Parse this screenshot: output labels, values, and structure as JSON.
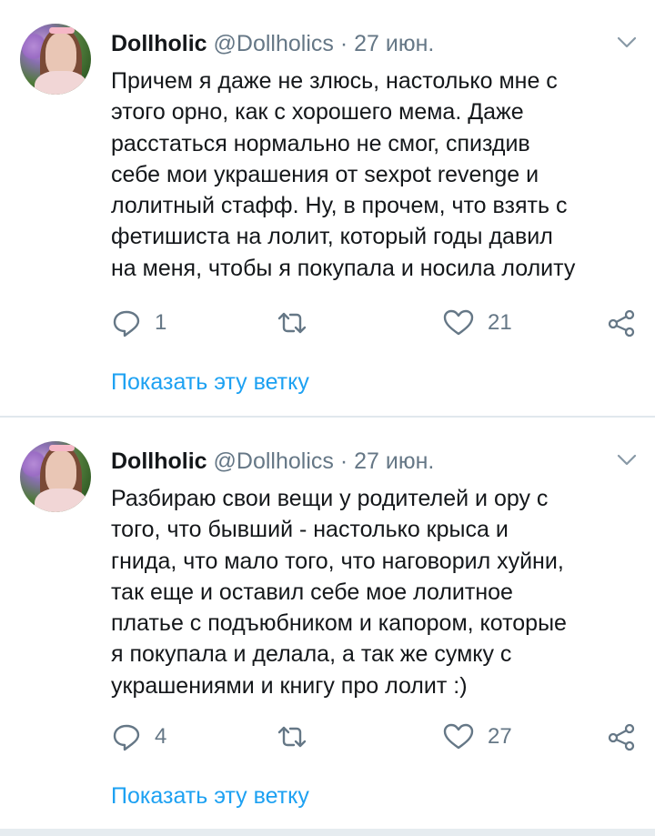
{
  "tweets": [
    {
      "author": {
        "name": "Dollholic",
        "handle": "@Dollholics",
        "separator": "·",
        "date": "27 июн."
      },
      "text_lines": [
        "Причем я даже не злюсь,  настолько мне с",
        "этого орно, как с хорошего мема. Даже",
        "расстаться нормально не смог, спиздив",
        "себе мои украшения от sexpot revenge и",
        "лолитный стафф. Ну,  в прочем,  что взять с",
        "фетишиста на лолит, который годы давил",
        "на меня, чтобы я покупала и носила лолиту"
      ],
      "actions": {
        "reply_count": "1",
        "retweet_count": "",
        "like_count": "21"
      },
      "thread_link": "Показать эту ветку"
    },
    {
      "author": {
        "name": "Dollholic",
        "handle": "@Dollholics",
        "separator": "·",
        "date": "27 июн."
      },
      "text_lines": [
        "Разбираю свои вещи у родителей и ору с",
        "того, что бывший - настолько крыса и",
        "гнида, что мало того, что наговорил хуйни,",
        "так еще и оставил себе мое лолитное",
        "платье с подъюбником и капором, которые",
        "я покупала и делала, а так же сумку с",
        "украшениями и книгу про лолит :)"
      ],
      "actions": {
        "reply_count": "4",
        "retweet_count": "",
        "like_count": "27"
      },
      "thread_link": "Показать эту ветку"
    }
  ],
  "icons": {
    "reply": "reply-icon",
    "retweet": "retweet-icon",
    "like": "heart-icon",
    "share": "share-icon",
    "menu": "chevron-down-icon"
  },
  "colors": {
    "text": "#14171a",
    "secondary": "#657786",
    "link": "#1da1f2",
    "divider": "#e1e8ed"
  }
}
